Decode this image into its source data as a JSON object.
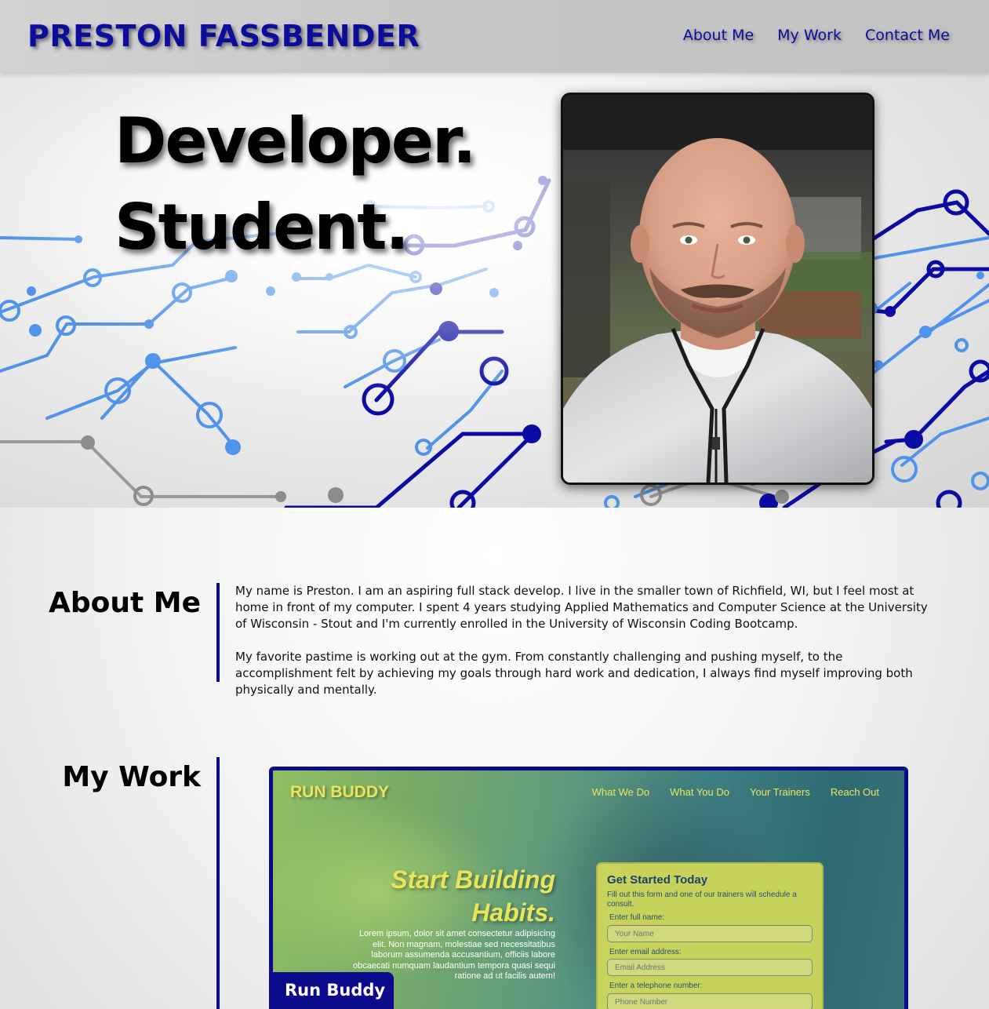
{
  "header": {
    "brand": "PRESTON FASSBENDER",
    "nav": [
      "About Me",
      "My Work",
      "Contact Me"
    ]
  },
  "hero": {
    "line1": "Developer.",
    "line2": "Student."
  },
  "about": {
    "title": "About Me",
    "paragraph1": "My name is Preston. I am an aspiring full stack develop. I live in the smaller town of Richfield, WI, but I feel most at home in front of my computer. I spent 4 years studying Applied Mathematics and Computer Science at the University of Wisconsin - Stout and I'm currently enrolled in the University of Wisconsin Coding Bootcamp.",
    "paragraph2": "My favorite pastime is working out at the gym. From constantly challenging and pushing myself, to the accomplishment felt by achieving my goals through hard work and dedication, I always find myself improving both physically and mentally."
  },
  "work": {
    "title": "My Work",
    "projects": [
      {
        "label": "Run Buddy",
        "preview": {
          "logo": "RUN BUDDY",
          "nav": [
            "What We Do",
            "What You Do",
            "Your Trainers",
            "Reach Out"
          ],
          "hero_title_1": "Start Building",
          "hero_title_2": "Habits.",
          "hero_body": "Lorem ipsum, dolor sit amet consectetur adipisicing elit. Non magnam, molestiae sed necessitatibus laborum assumenda accusantium, officiis labore obcaecati numquam laudantium tempora quasi sequi ratione ad ut facilis autem!",
          "form_title": "Get Started Today",
          "form_sub": "Fill out this form and one of our trainers will schedule a consult.",
          "fields": [
            {
              "label": "Enter full name:",
              "placeholder": "Your Name"
            },
            {
              "label": "Enter email address:",
              "placeholder": "Email Address"
            },
            {
              "label": "Enter a telephone number:",
              "placeholder": "Phone Number"
            }
          ]
        }
      }
    ]
  },
  "colors": {
    "accent": "#0d0d9c",
    "divider": "#0a0a8a",
    "preview_yellow": "#e8e55c"
  }
}
